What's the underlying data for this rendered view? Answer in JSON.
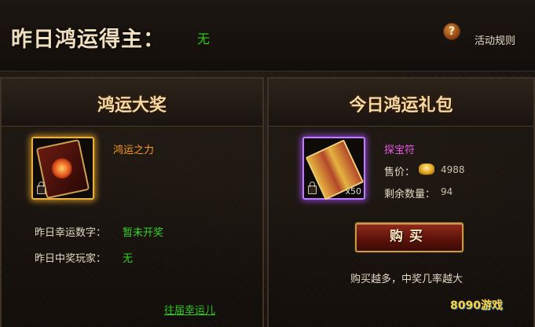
{
  "header": {
    "winner_label": "昨日鸿运得主：",
    "winner_value": "无",
    "help_icon_glyph": "?",
    "rules_label": "活动规则"
  },
  "left_panel": {
    "title": "鸿运大奖",
    "item_name": "鸿运之力",
    "lucky_number_label": "昨日幸运数字：",
    "lucky_number_value": "暂未开奖",
    "winner_player_label": "昨日中奖玩家：",
    "winner_player_value": "无",
    "past_link": "往届幸运儿"
  },
  "right_panel": {
    "title": "今日鸿运礼包",
    "item_name": "探宝符",
    "item_quantity": "x50",
    "price_label": "售价：",
    "price_value": "4988",
    "remaining_label": "剩余数量：",
    "remaining_value": "94",
    "buy_label": "购买",
    "hint": "购买越多，中奖几率越大"
  },
  "watermark": "8090游戏",
  "colors": {
    "accent_green": "#2ec81f",
    "item_orange": "#ff9a1e",
    "item_magenta": "#e85ae6",
    "title_gold": "#f3d9a6"
  },
  "icons": {
    "help": "question-mark-icon",
    "lock": "lock-icon",
    "currency": "gold-ingot-icon"
  }
}
